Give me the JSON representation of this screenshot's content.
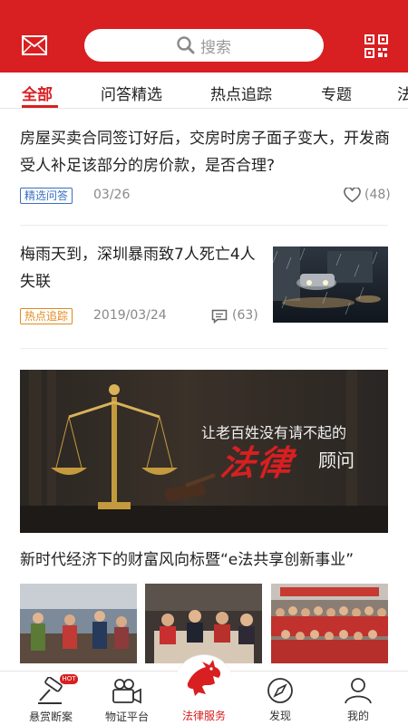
{
  "header": {
    "search_placeholder": "搜索",
    "mail_icon": "mail-icon",
    "qr_icon": "qr-code-icon",
    "brand_color": "#d81f21"
  },
  "tabs": [
    {
      "label": "全部",
      "active": true
    },
    {
      "label": "问答精选"
    },
    {
      "label": "热点追踪"
    },
    {
      "label": "专题"
    },
    {
      "label": "法"
    }
  ],
  "articles": [
    {
      "title": "房屋买卖合同签订好后，交房时房子面子变大，开发商受人补足该部分的房价款，是否合理?",
      "tag": "精选问答",
      "date": "03/26",
      "likes": "(48)"
    },
    {
      "title": "梅雨天到，深圳暴雨致7人死亡4人失联",
      "tag": "热点追踪",
      "date": "2019/03/24",
      "comments": "(63)"
    }
  ],
  "banner": {
    "tagline": "让老百姓没有请不起的",
    "big": "法律",
    "small": "顾问"
  },
  "article3": {
    "title": "新时代经济下的财富风向标暨“e法共享创新事业”"
  },
  "bottom_nav": [
    {
      "label": "悬赏断案",
      "badge": "HOT",
      "icon": "gavel-icon"
    },
    {
      "label": "物证平台",
      "icon": "video-camera-icon"
    },
    {
      "label": "法律服务",
      "icon": "dragon-logo-icon",
      "active": true
    },
    {
      "label": "发现",
      "icon": "compass-icon"
    },
    {
      "label": "我的",
      "icon": "user-icon"
    }
  ]
}
